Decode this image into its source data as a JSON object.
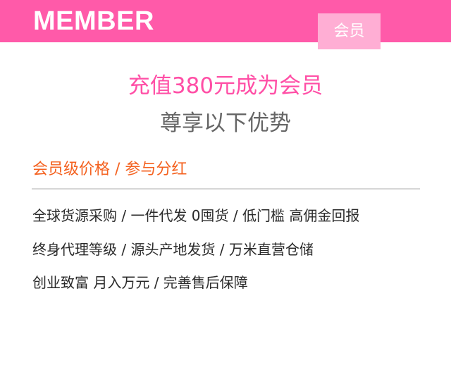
{
  "header": {
    "title": "MEMBER",
    "badge": "会员",
    "colors": {
      "bar": "#ff5aa9",
      "badge": "#ffaed4"
    }
  },
  "main": {
    "headline": "充值380元成为会员",
    "subhead": "尊享以下优势",
    "section_title": "会员级价格  /  参与分红",
    "benefits": [
      "全球货源采购  /  一件代发 0囤货  /  低门槛 高佣金回报",
      "终身代理等级  /  源头产地发货  /  万米直营仓储",
      "创业致富 月入万元  /  完善售后保障"
    ],
    "colors": {
      "headline": "#ff4fa6",
      "section_title": "#f46220"
    }
  }
}
